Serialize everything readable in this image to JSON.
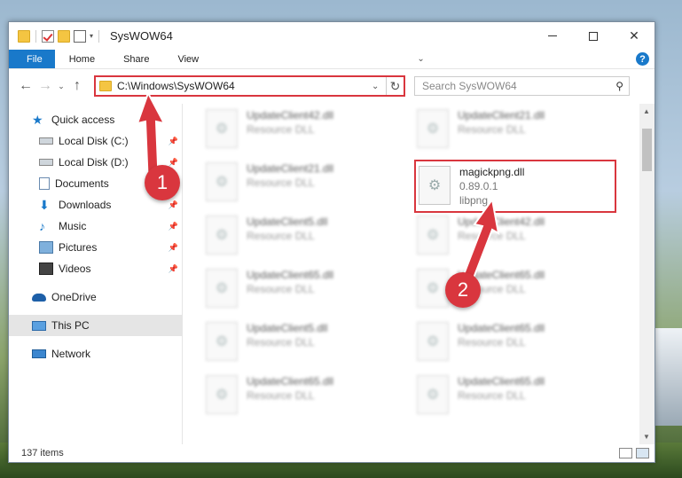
{
  "window": {
    "title": "SysWOW64"
  },
  "ribbon": {
    "tabs": [
      "File",
      "Home",
      "Share",
      "View"
    ],
    "help": "?"
  },
  "address": {
    "path": "C:\\Windows\\SysWOW64"
  },
  "search": {
    "placeholder": "Search SysWOW64"
  },
  "nav": {
    "items": [
      {
        "label": "Quick access",
        "icon": "star-icon",
        "pinned": false
      },
      {
        "label": "Local Disk (C:)",
        "icon": "drive-icon",
        "pinned": true
      },
      {
        "label": "Local Disk (D:)",
        "icon": "drive-icon",
        "pinned": true
      },
      {
        "label": "Documents",
        "icon": "documents-icon",
        "pinned": true
      },
      {
        "label": "Downloads",
        "icon": "download-icon",
        "pinned": true
      },
      {
        "label": "Music",
        "icon": "music-icon",
        "pinned": true
      },
      {
        "label": "Pictures",
        "icon": "pictures-icon",
        "pinned": true
      },
      {
        "label": "Videos",
        "icon": "videos-icon",
        "pinned": true
      }
    ],
    "onedrive": "OneDrive",
    "thispc": "This PC",
    "network": "Network"
  },
  "files": [
    {
      "name": "UpdateClient42.dll",
      "sub": "Resource DLL"
    },
    {
      "name": "UpdateClient21.dll",
      "sub": "Resource DLL"
    },
    {
      "name": "UpdateClient21.dll",
      "sub": "Resource DLL"
    },
    {
      "name": "magickpng.dll",
      "sub": "0.89.0.1",
      "sub2": "libpng",
      "highlight": true
    },
    {
      "name": "UpdateClient5.dll",
      "sub": "Resource DLL"
    },
    {
      "name": "UpdateClient42.dll",
      "sub": "Resource DLL"
    },
    {
      "name": "UpdateClient65.dll",
      "sub": "Resource DLL"
    },
    {
      "name": "UpdateClient65.dll",
      "sub": "Resource DLL"
    },
    {
      "name": "UpdateClient5.dll",
      "sub": "Resource DLL"
    },
    {
      "name": "UpdateClient65.dll",
      "sub": "Resource DLL"
    },
    {
      "name": "UpdateClient65.dll",
      "sub": "Resource DLL"
    },
    {
      "name": "UpdateClient65.dll",
      "sub": "Resource DLL"
    }
  ],
  "status": {
    "count": "137 items"
  },
  "badges": [
    "1",
    "2"
  ],
  "colors": {
    "accent": "#1979ca",
    "highlight": "#d9363e"
  }
}
